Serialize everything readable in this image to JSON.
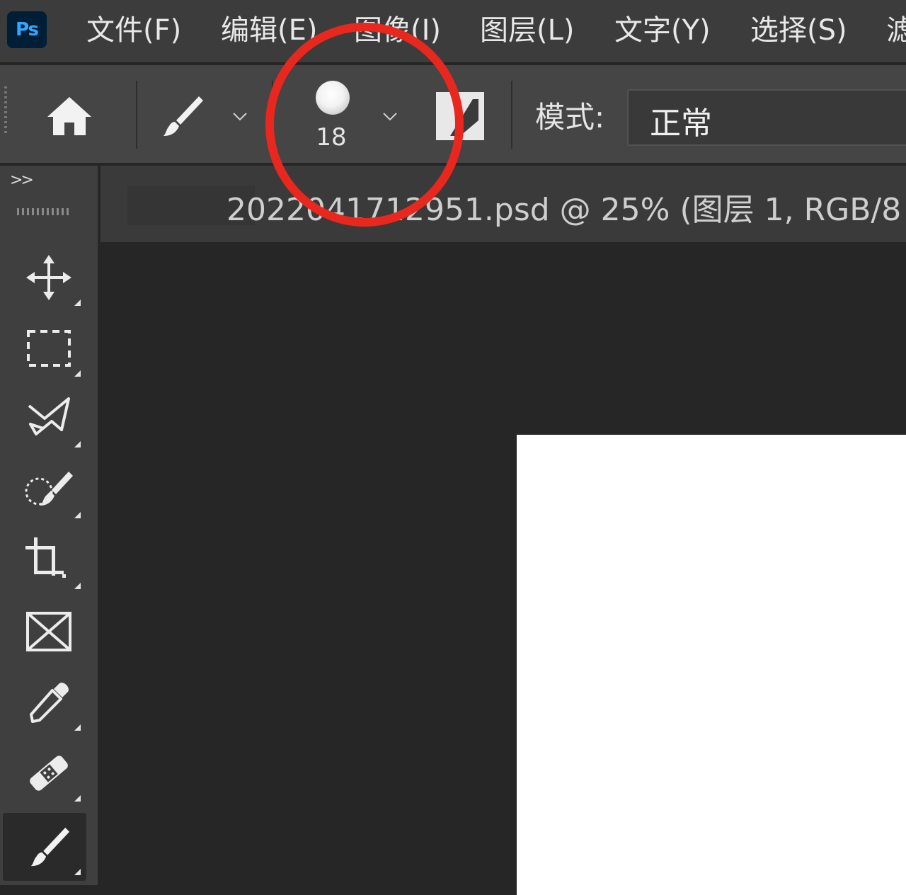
{
  "app": {
    "logo_text": "Ps"
  },
  "menu": {
    "items": [
      {
        "label": "文件(F)"
      },
      {
        "label": "编辑(E)"
      },
      {
        "label": "图像(I)"
      },
      {
        "label": "图层(L)"
      },
      {
        "label": "文字(Y)"
      },
      {
        "label": "选择(S)"
      },
      {
        "label": "滤"
      }
    ]
  },
  "options_bar": {
    "home_icon": "home-icon",
    "tool_preset_icon": "brush-icon",
    "brush_size": "18",
    "mode_label": "模式:",
    "mode_value": "正常"
  },
  "toolbar": {
    "collapse_label": ">>",
    "tools": [
      {
        "name": "move-tool",
        "icon": "move-icon"
      },
      {
        "name": "marquee-tool",
        "icon": "rect-marquee-icon"
      },
      {
        "name": "lasso-tool",
        "icon": "lasso-icon"
      },
      {
        "name": "quick-select-tool",
        "icon": "quick-select-icon"
      },
      {
        "name": "crop-tool",
        "icon": "crop-icon"
      },
      {
        "name": "frame-tool",
        "icon": "frame-icon"
      },
      {
        "name": "eyedropper-tool",
        "icon": "eyedropper-icon"
      },
      {
        "name": "healing-tool",
        "icon": "bandage-icon"
      },
      {
        "name": "brush-tool",
        "icon": "brush-icon",
        "active": true
      }
    ]
  },
  "document": {
    "title": "2022041712951.psd @ 25% (图层 1, RGB/8"
  },
  "colors": {
    "annotation": "#e8281e",
    "canvas": "#ffffff",
    "workspace": "#262626"
  }
}
